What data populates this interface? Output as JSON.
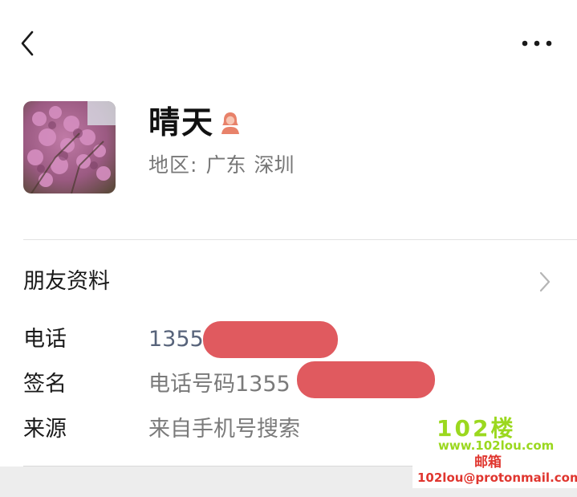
{
  "header": {
    "back_icon": "chevron-left-icon",
    "more_icon": "more-horizontal-icon"
  },
  "profile": {
    "name": "晴天",
    "gender_icon": "female-user-icon",
    "gender_color": "#e8826a",
    "region_label": "地区:",
    "region_province": "广东",
    "region_city": "深圳"
  },
  "friend_info": {
    "title": "朋友资料",
    "chevron_icon": "chevron-right-icon"
  },
  "rows": {
    "phone": {
      "label": "电话",
      "value": "1355"
    },
    "signature": {
      "label": "签名",
      "value": "电话号码1355"
    },
    "source": {
      "label": "来源",
      "value": "来自手机号搜索"
    }
  },
  "colors": {
    "redaction": "#e05a5f",
    "phone_text": "#57637a",
    "watermark_green": "#9bd81f",
    "watermark_red": "#e0362f"
  },
  "watermark": {
    "logo": "102楼",
    "url": "www.102lou.com",
    "mail_label": "邮箱",
    "email": "102lou@protonmail.com"
  }
}
